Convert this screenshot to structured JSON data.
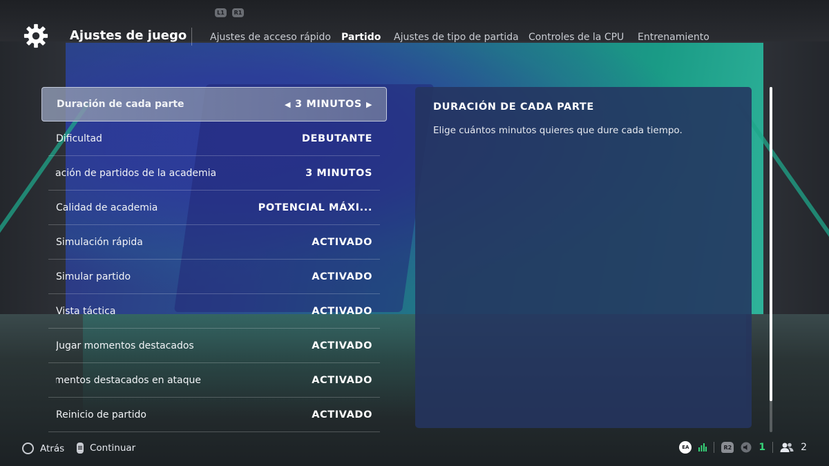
{
  "header": {
    "title": "Ajustes de juego",
    "shoulder_left": "L1",
    "shoulder_right": "R1",
    "tabs": [
      {
        "label": "Ajustes de acceso rápido",
        "active": false
      },
      {
        "label": "Partido",
        "active": true
      },
      {
        "label": "Ajustes de tipo de partida",
        "active": false
      },
      {
        "label": "Controles de la CPU",
        "active": false
      },
      {
        "label": "Entrenamiento",
        "active": false
      }
    ]
  },
  "settings": [
    {
      "label": "Duración de cada parte",
      "value": "3 MINUTOS",
      "selected": true
    },
    {
      "label": "Dificultad",
      "value": "DEBUTANTE"
    },
    {
      "label": "ación de partidos de la academia",
      "value": "3 MINUTOS"
    },
    {
      "label": "Calidad de academia",
      "value": "POTENCIAL MÁXI..."
    },
    {
      "label": "Simulación rápida",
      "value": "ACTIVADO"
    },
    {
      "label": "Simular partido",
      "value": "ACTIVADO"
    },
    {
      "label": "Vista táctica",
      "value": "ACTIVADO"
    },
    {
      "label": "Jugar momentos destacados",
      "value": "ACTIVADO"
    },
    {
      "label": "Momentos destacados en ataque",
      "value": "ACTIVADO"
    },
    {
      "label": "Reinicio de partido",
      "value": "ACTIVADO"
    }
  ],
  "selector": {
    "left_arrow": "◀",
    "right_arrow": "▶"
  },
  "panel": {
    "title": "DURACIÓN DE CADA PARTE",
    "description": "Elige cuántos minutos quieres que dure cada tiempo."
  },
  "footer": {
    "back_label": "Atrás",
    "continue_label": "Continuar",
    "ea_label": "EA",
    "r2_label": "R2",
    "voice_count": "1",
    "party_count": "2"
  },
  "colors": {
    "accent_green": "#37d67a",
    "panel_bg": "#243460",
    "teal": "#1fa58a"
  }
}
